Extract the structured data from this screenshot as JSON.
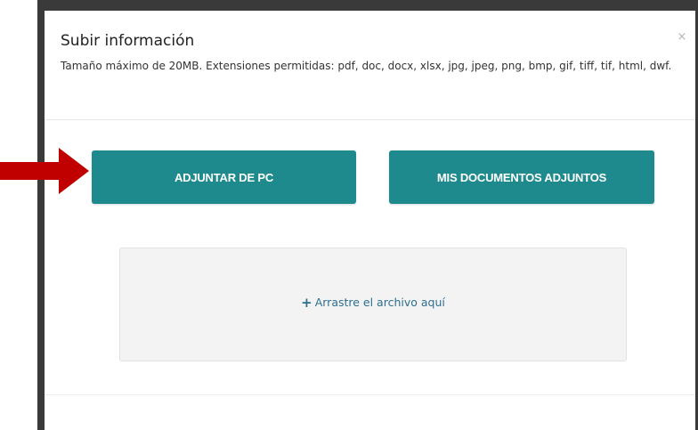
{
  "modal": {
    "title": "Subir información",
    "subtitle": "Tamaño máximo de 20MB. Extensiones permitidas: pdf, doc, docx, xlsx, jpg, jpeg, png, bmp, gif, tiff, tif, html, dwf.",
    "close_label": "×"
  },
  "buttons": {
    "attach_from_pc": "ADJUNTAR DE PC",
    "my_attachments": "MIS DOCUMENTOS ADJUNTOS"
  },
  "dropzone": {
    "icon": "plus-icon",
    "plus_glyph": "+",
    "label": "Arrastre el archivo aquí"
  },
  "colors": {
    "button_bg": "#1f8a8e",
    "button_text": "#ffffff",
    "dropzone_bg": "#f3f3f3",
    "dropzone_text": "#2d6f8f",
    "arrow": "#c00000"
  }
}
